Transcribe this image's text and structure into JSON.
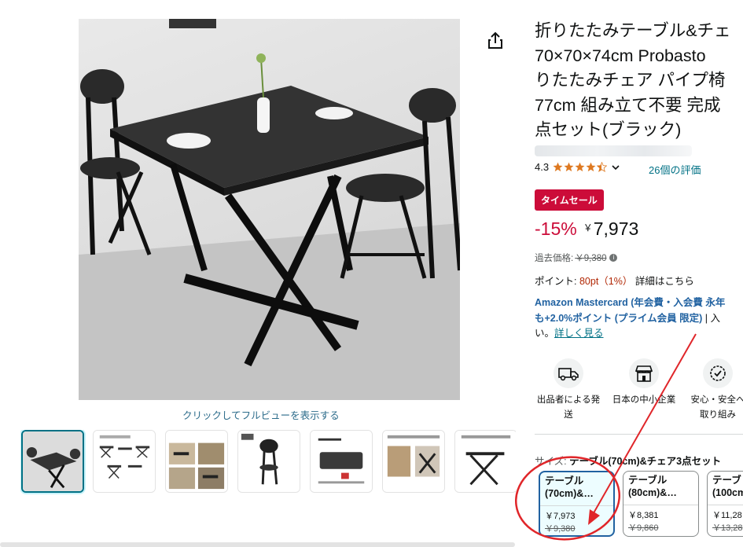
{
  "gallery": {
    "fullview_link": "クリックしてフルビューを表示する",
    "thumbnails": [
      "thumb-1",
      "thumb-2",
      "thumb-3",
      "thumb-4",
      "thumb-5",
      "thumb-6",
      "thumb-7"
    ]
  },
  "product": {
    "title_lines": [
      "折りたたみテーブル&チェ",
      "70×70×74cm Probasto",
      "りたたみチェア パイプ椅",
      "77cm 組み立て不要 完成",
      "点セット(ブラック)"
    ],
    "rating": "4.3",
    "stars": 4.3,
    "reviews": "26個の評価",
    "sale_badge": "タイムセール",
    "discount": "-15%",
    "currency": "￥",
    "price": "7,973",
    "old_price_label": "過去価格:",
    "old_price": "￥9,380",
    "points_label": "ポイント:",
    "points_value": "80pt（1%）",
    "points_link": "詳細はこちら"
  },
  "card_promo": {
    "line1_bold": "Amazon Mastercard",
    "line1_rest": " (年会費・入会費 永年",
    "line2_bold": "も+2.0%ポイント (プライム会員 限定)",
    "line2_rest": " | 入",
    "line3_rest": "い。",
    "line3_link": "詳しく見る"
  },
  "features": [
    {
      "icon": "truck-icon",
      "line1": "出品者による発",
      "line2": "送"
    },
    {
      "icon": "shop-icon",
      "line1": "日本の中小企業",
      "line2": ""
    },
    {
      "icon": "shield-check-icon",
      "line1": "安心・安全へ",
      "line2": "取り組み"
    }
  ],
  "size": {
    "label": "サイズ:",
    "selected": "テーブル(70cm)&チェア3点セット",
    "options": [
      {
        "name_l1": "テーブル",
        "name_l2": "(70cm)&…",
        "price": "￥7,973",
        "old": "￥9,380"
      },
      {
        "name_l1": "テーブル",
        "name_l2": "(80cm)&…",
        "price": "￥8,381",
        "old": "￥9,860"
      },
      {
        "name_l1": "テーブ",
        "name_l2": "(100cm",
        "price": "￥11,28",
        "old": "￥13,28"
      }
    ]
  },
  "colors": {
    "accent": "#007185",
    "sale": "#cc0c39",
    "star": "#de7921",
    "annotation": "#e0262a"
  }
}
